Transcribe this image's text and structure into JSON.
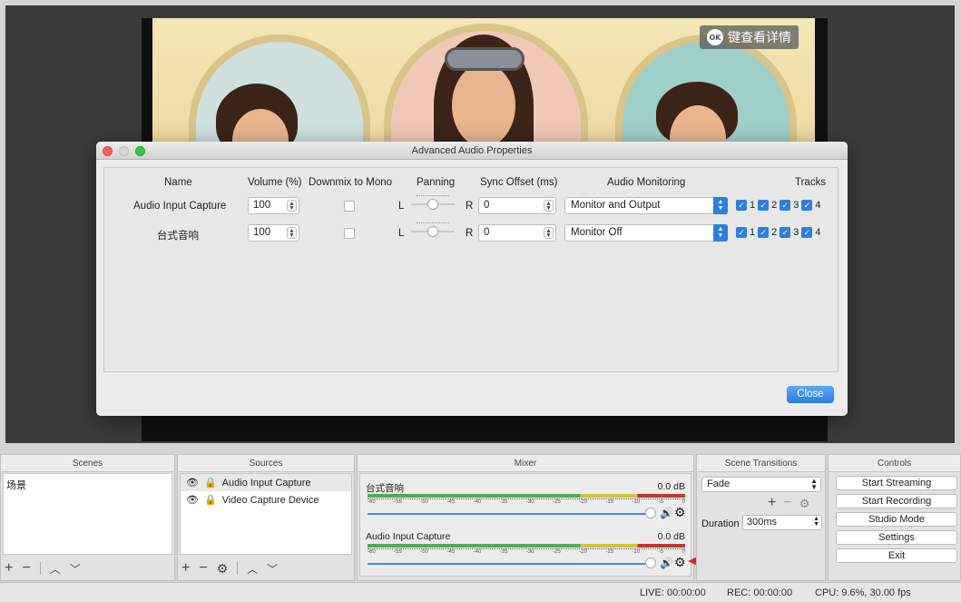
{
  "preview": {
    "badge_icon": "OK",
    "badge_text": "键查看详情"
  },
  "dialog": {
    "title": "Advanced Audio Properties",
    "headers": {
      "name": "Name",
      "volume": "Volume (%)",
      "downmix": "Downmix to Mono",
      "panning": "Panning",
      "sync": "Sync Offset (ms)",
      "monitoring": "Audio Monitoring",
      "tracks": "Tracks"
    },
    "pan_left": "L",
    "pan_right": "R",
    "rows": [
      {
        "name": "Audio Input Capture",
        "volume": "100",
        "sync": "0",
        "monitoring": "Monitor and Output",
        "tracks": [
          "1",
          "2",
          "3",
          "4"
        ]
      },
      {
        "name": "台式音响",
        "volume": "100",
        "sync": "0",
        "monitoring": "Monitor Off",
        "tracks": [
          "1",
          "2",
          "3",
          "4"
        ]
      }
    ],
    "close_label": "Close"
  },
  "scenes": {
    "title": "Scenes",
    "items": [
      "场景"
    ]
  },
  "sources": {
    "title": "Sources",
    "items": [
      "Audio Input Capture",
      "Video Capture Device"
    ]
  },
  "mixer": {
    "title": "Mixer",
    "scale": [
      "-60",
      "-55",
      "-50",
      "-45",
      "-40",
      "-35",
      "-30",
      "-25",
      "-20",
      "-15",
      "-10",
      "-5",
      "0"
    ],
    "channels": [
      {
        "name": "台式音响",
        "db": "0.0 dB"
      },
      {
        "name": "Audio Input Capture",
        "db": "0.0 dB"
      }
    ]
  },
  "transitions": {
    "title": "Scene Transitions",
    "selected": "Fade",
    "duration_label": "Duration",
    "duration_value": "300ms"
  },
  "controls": {
    "title": "Controls",
    "buttons": [
      "Start Streaming",
      "Start Recording",
      "Studio Mode",
      "Settings",
      "Exit"
    ]
  },
  "status": {
    "live": "LIVE: 00:00:00",
    "rec": "REC: 00:00:00",
    "cpu": "CPU: 9.6%, 30.00 fps"
  },
  "colors": {
    "accent": "#2e7de1",
    "arrow": "#e02020"
  }
}
